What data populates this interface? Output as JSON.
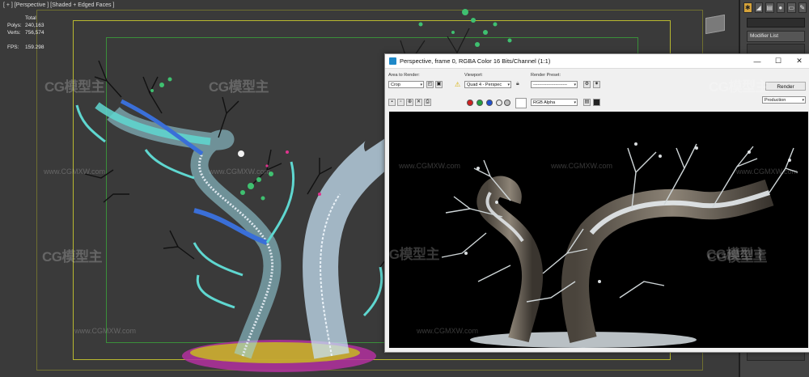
{
  "viewport": {
    "label": "[ + ] [Perspective ] [Shaded + Edged Faces ]",
    "stats": {
      "header": "Total",
      "polys_label": "Polys:",
      "polys_value": "240,163",
      "verts_label": "Verts:",
      "verts_value": "756,574",
      "fps_label": "FPS:",
      "fps_value": "159.298"
    }
  },
  "render_window": {
    "title": "Perspective, frame 0, RGBA Color 16 Bits/Channel (1:1)",
    "controls": {
      "minimize": "—",
      "maximize": "☐",
      "close": "✕"
    },
    "area_to_render": {
      "label": "Area to Render:",
      "value": "Crop"
    },
    "viewport_select": {
      "label": "Viewport:",
      "value": "Quad 4 - Perspec"
    },
    "render_preset": {
      "label": "Render Preset:",
      "value": "-----------------------"
    },
    "render_button": "Render",
    "production_select": "Production",
    "channel_select": "RGB Alpha"
  },
  "command_panel": {
    "modifier_list": "Modifier List"
  },
  "watermark": {
    "brand": "CG模型主",
    "url": "www.CGMXW.com"
  },
  "colors": {
    "viewport_bg": "#3a3a3a",
    "wire_cyan": "#5fd7d0",
    "wire_blue": "#3a6fd8",
    "leaf_green": "#3fc070",
    "ground_yellow": "#c9c21a",
    "ground_magenta": "#c23ab0",
    "snow_white": "#e6ebee"
  }
}
